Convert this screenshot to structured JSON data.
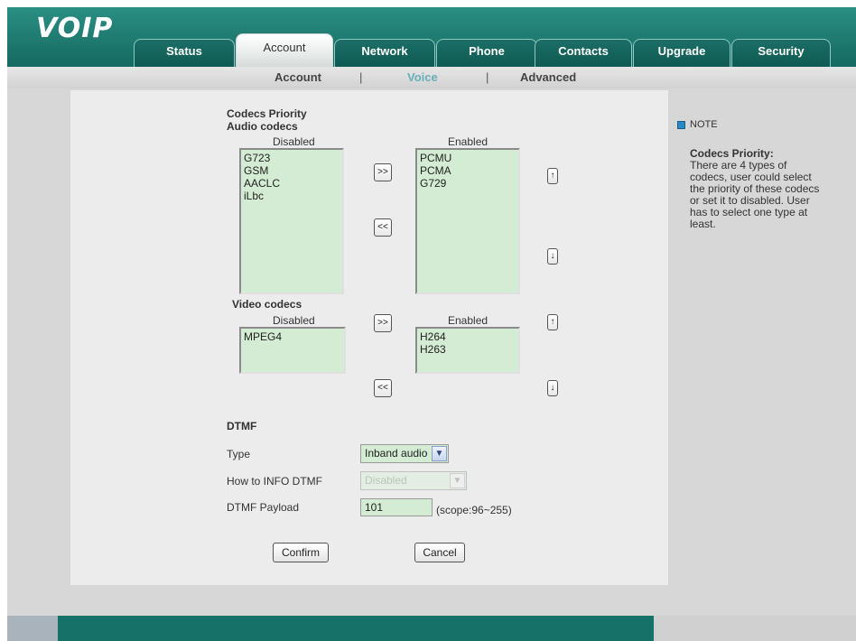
{
  "header": {
    "logo": "VOIP"
  },
  "tabs": [
    {
      "label": "Status",
      "active": false
    },
    {
      "label": "Account",
      "active": true
    },
    {
      "label": "Network",
      "active": false
    },
    {
      "label": "Phone",
      "active": false
    },
    {
      "label": "Contacts",
      "active": false
    },
    {
      "label": "Upgrade",
      "active": false
    },
    {
      "label": "Security",
      "active": false
    }
  ],
  "subnav": {
    "items": [
      {
        "label": "Account",
        "active": false
      },
      {
        "label": "Voice",
        "active": true
      },
      {
        "label": "Advanced",
        "active": false
      }
    ],
    "separator": "|"
  },
  "codecs": {
    "section_title": "Codecs Priority",
    "audio": {
      "title": "Audio codecs",
      "disabled_label": "Disabled",
      "enabled_label": "Enabled",
      "disabled_items": [
        "G723",
        "GSM",
        "AACLC",
        "iLbc"
      ],
      "enabled_items": [
        "PCMU",
        "PCMA",
        "G729"
      ]
    },
    "video": {
      "title": "Video codecs",
      "disabled_label": "Disabled",
      "enabled_label": "Enabled",
      "disabled_items": [
        "MPEG4"
      ],
      "enabled_items": [
        "H264",
        "H263"
      ]
    },
    "buttons": {
      "add": ">>",
      "remove": "<<",
      "up": "↑",
      "down": "↓"
    }
  },
  "dtmf": {
    "title": "DTMF",
    "type_label": "Type",
    "type_value": "Inband audio",
    "info_label": "How to INFO DTMF",
    "info_value": "Disabled",
    "payload_label": "DTMF Payload",
    "payload_value": "101",
    "payload_scope": "(scope:96~255)"
  },
  "actions": {
    "confirm": "Confirm",
    "cancel": "Cancel"
  },
  "note": {
    "title": "NOTE",
    "heading": "Codecs Priority:",
    "text": "There are 4 types of codecs, user could select the priority of these codecs or set it to disabled. User has to select one type at least."
  },
  "colors": {
    "brand_teal": "#1f7a70",
    "list_green": "#d3ecd3",
    "active_sub": "#66b0b8"
  }
}
